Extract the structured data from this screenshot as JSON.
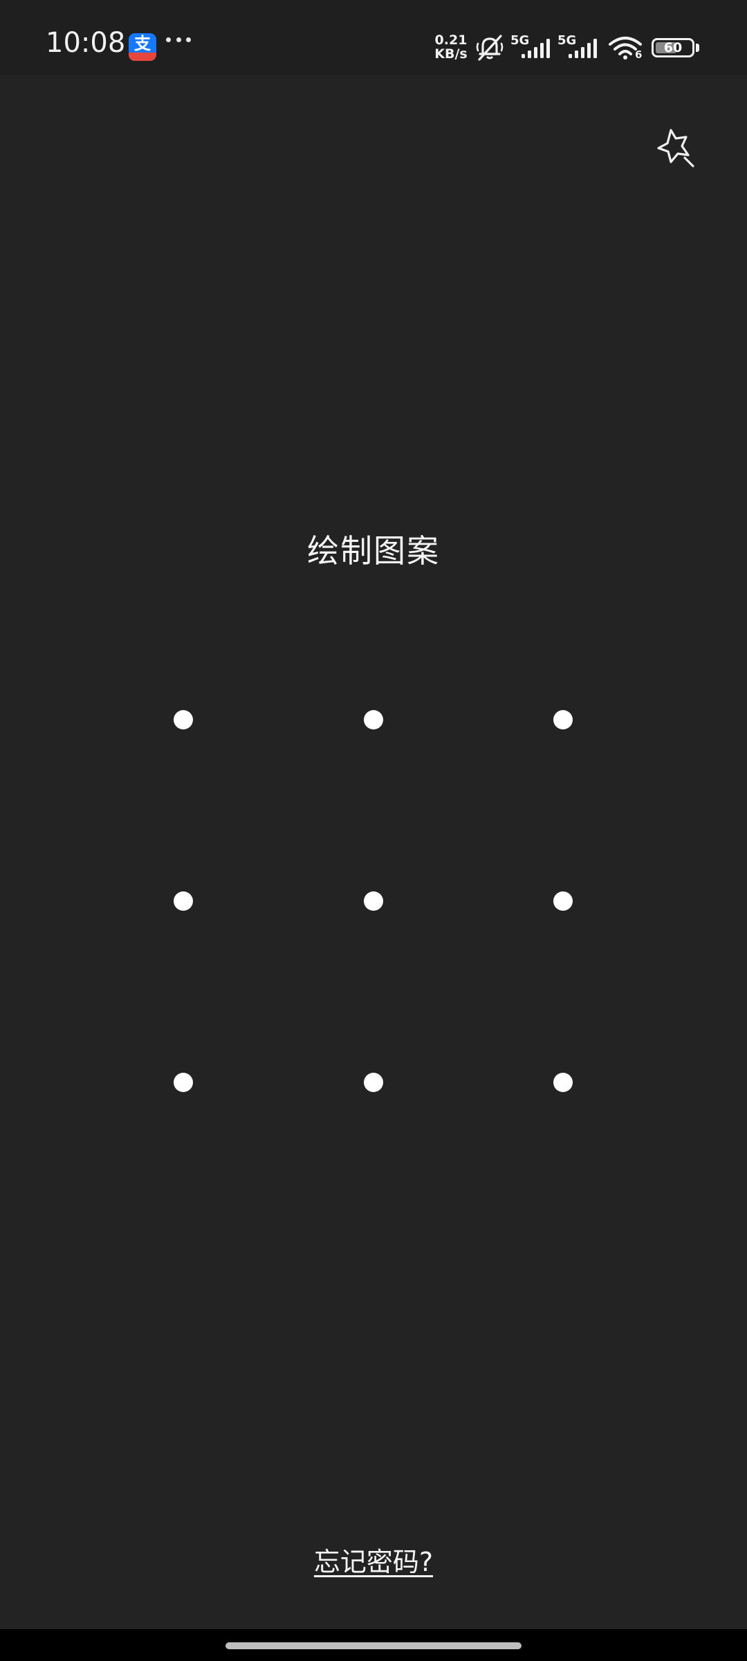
{
  "status_bar": {
    "time": "10:08",
    "notification_app": {
      "icon": "alipay-icon",
      "glyph": "支",
      "brand_color": "#1677ff",
      "band_color": "#e6463c"
    },
    "more_notifications": "more-dots-icon",
    "net_speed_value": "0.21",
    "net_speed_unit": "KB/s",
    "ringer": "bell-off-icon",
    "sim1_label": "5G",
    "sim2_label": "5G",
    "wifi_label": "6",
    "battery_level": "60",
    "battery_fraction": 0.6
  },
  "top_action": {
    "icon": "magic-wand-star-icon"
  },
  "title": "绘制图案",
  "pattern": {
    "rows": 3,
    "cols": 3,
    "dot_color": "#ffffff"
  },
  "forgot_link": "忘记密码?",
  "colors": {
    "background": "#232323",
    "status_bar": "#1f1f1f",
    "nav_bar": "#000000",
    "text": "#f5f5f5"
  }
}
